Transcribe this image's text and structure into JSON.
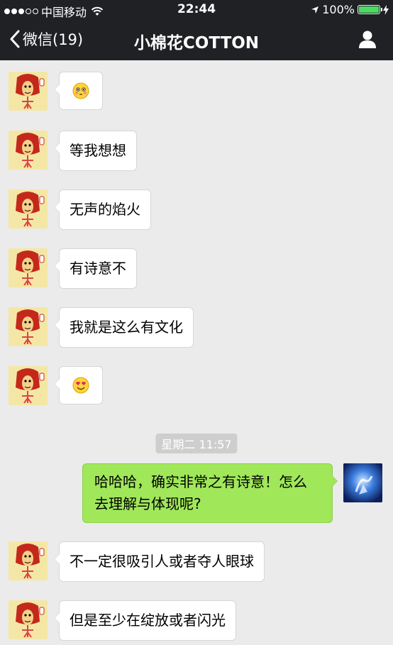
{
  "status_bar": {
    "carrier": "中国移动",
    "time": "22:44",
    "battery": "100%"
  },
  "nav": {
    "back_label": "微信(19)",
    "title": "小棉花COTTON"
  },
  "messages": [
    {
      "side": "left",
      "type": "emoji",
      "emoji": "flushed-face"
    },
    {
      "side": "left",
      "type": "text",
      "text": "等我想想"
    },
    {
      "side": "left",
      "type": "text",
      "text": "无声的焰火"
    },
    {
      "side": "left",
      "type": "text",
      "text": "有诗意不"
    },
    {
      "side": "left",
      "type": "text",
      "text": "我就是这么有文化"
    },
    {
      "side": "left",
      "type": "emoji",
      "emoji": "heart-eyes-face"
    },
    {
      "type": "timestamp",
      "text": "星期二 11:57"
    },
    {
      "side": "right",
      "type": "text",
      "line1": "哈哈哈，确实非常之有诗意！怎么",
      "line2": "去理解与体现呢?"
    },
    {
      "side": "left",
      "type": "text",
      "text": "不一定很吸引人或者夺人眼球"
    },
    {
      "side": "left",
      "type": "text",
      "text": "但是至少在绽放或者闪光"
    }
  ]
}
